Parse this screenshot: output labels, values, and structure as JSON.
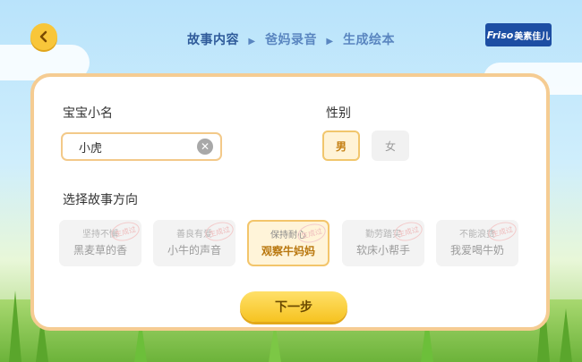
{
  "nav": {
    "back_icon": "chevron-left-icon",
    "steps": [
      "故事内容",
      "爸妈录音",
      "生成绘本"
    ],
    "separator": "▶",
    "logo_en": "Friso",
    "logo_cn": "美素佳儿"
  },
  "form": {
    "baby_name_label": "宝宝小名",
    "baby_name_value": "小虎",
    "gender_label": "性别",
    "gender_options": [
      "男",
      "女"
    ],
    "gender_selected": "男",
    "direction_label": "选择故事方向",
    "directions": [
      {
        "theme": "坚持不懈",
        "title": "黑麦草的香",
        "stamp": "生成过",
        "selected": false
      },
      {
        "theme": "善良有爱",
        "title": "小牛的声音",
        "stamp": "生成过",
        "selected": false
      },
      {
        "theme": "保持耐心",
        "title": "观察牛妈妈",
        "stamp": "生成过",
        "selected": true
      },
      {
        "theme": "勤劳踏实",
        "title": "软床小帮手",
        "stamp": "生成过",
        "selected": false
      },
      {
        "theme": "不能浪费",
        "title": "我爱喝牛奶",
        "stamp": "生成过",
        "selected": false
      }
    ],
    "next_label": "下一步"
  },
  "colors": {
    "accent_yellow": "#f6c321",
    "card_border": "#f5cc92",
    "step_blue": "#2f5b9a",
    "logo_blue": "#1d4ea3"
  }
}
